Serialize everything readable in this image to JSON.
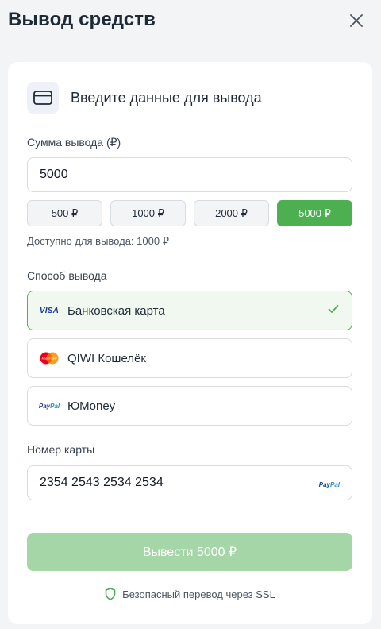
{
  "header": {
    "title": "Вывод средств"
  },
  "intro": {
    "text": "Введите данные для вывода"
  },
  "amount": {
    "label": "Сумма вывода (₽)",
    "value": "5000",
    "presets": [
      {
        "label": "500 ₽",
        "active": false
      },
      {
        "label": "1000 ₽",
        "active": false
      },
      {
        "label": "2000 ₽",
        "active": false
      },
      {
        "label": "5000 ₽",
        "active": true
      }
    ],
    "available_text": "Доступно для вывода: 1000 ₽"
  },
  "method": {
    "label": "Способ вывода",
    "options": [
      {
        "label": "Банковская карта",
        "logo": "visa-logo",
        "selected": true
      },
      {
        "label": "QIWI Кошелёк",
        "logo": "mastercard-logo",
        "selected": false
      },
      {
        "label": "ЮMoney",
        "logo": "paypal-logo",
        "selected": false
      }
    ],
    "visa_logo_text": "VISA",
    "mastercard_logo_text": "MasterCard",
    "paypal_logo_text": {
      "pay": "Pay",
      "pal": "Pal"
    }
  },
  "card_number": {
    "label": "Номер карты",
    "value": "2354 2543 2534 2534",
    "logo": "paypal-logo"
  },
  "submit": {
    "label": "Вывести 5000 ₽"
  },
  "security": {
    "text": "Безопасный перевод через SSL",
    "icon": "shield-icon"
  },
  "colors": {
    "accent": "#4caf50",
    "accent_disabled": "#a5d6a7",
    "selected_bg": "#f1f8ef",
    "background": "#f3f4f6"
  }
}
